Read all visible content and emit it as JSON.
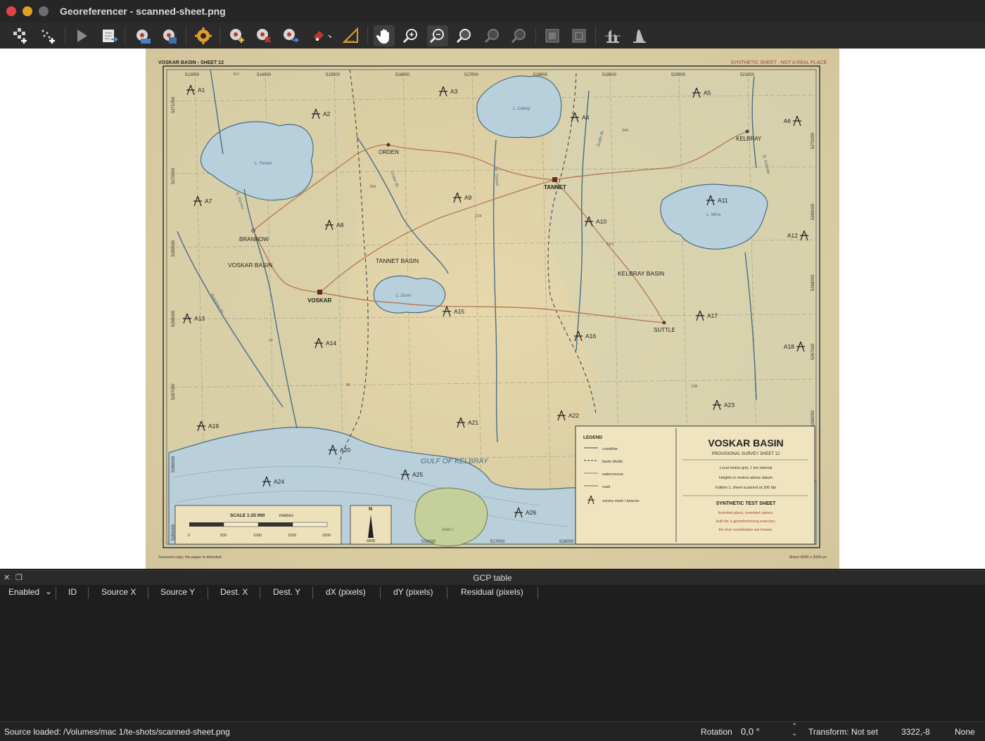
{
  "window": {
    "title": "Georeferencer - scanned-sheet.png"
  },
  "toolbar": {
    "icons": [
      "add-raster-icon",
      "add-point-icon",
      "start-georeferencing-icon",
      "generate-script-icon",
      "load-gcp-icon",
      "save-gcp-icon",
      "transformation-settings-icon",
      "add-gcp-icon",
      "delete-gcp-icon",
      "move-gcp-icon",
      "move-gcp-dest-icon",
      "full-histogram-icon",
      "pan-icon",
      "zoom-in-icon",
      "zoom-out-icon",
      "zoom-to-layer-icon",
      "zoom-last-icon",
      "zoom-next-icon",
      "link-georef-icon",
      "link-qgis-icon",
      "local-histogram-icon",
      "full-histogram-stretch-icon"
    ]
  },
  "map": {
    "sheet_label": "VOSKAR BASIN - SHEET 12",
    "disclaimer": "SYNTHETIC SHEET · NOT A REAL PLACE",
    "footer_left": "Scanned copy; the paper is distorted.",
    "footer_right": "Sheet 4000 x 3000 px",
    "eastings": [
      "513000",
      "514000",
      "515000",
      "516000",
      "517000",
      "518000",
      "519000",
      "520000",
      "521000"
    ],
    "northings": [
      "5271000",
      "5270000",
      "5269000",
      "5268000",
      "5268000",
      "5267000",
      "5266000",
      "5265000"
    ],
    "right_northings": [
      "5270000",
      "5269000",
      "5268000",
      "5267000",
      "5266000"
    ],
    "bottom_eastings": [
      "516000",
      "517000",
      "518000"
    ],
    "places": {
      "orden": "ORDEN",
      "tannet": "TANNET",
      "kelbray": "KELBRAY",
      "brannow": "BRANNOW",
      "voskar": "VOSKAR",
      "suttle": "SUTTLE",
      "voskar_basin": "VOSKAR BASIN",
      "tannet_basin": "TANNET BASIN",
      "kelbray_basin": "KELBRAY BASIN",
      "gulf": "GULF OF KELBRAY"
    },
    "lakes": {
      "ferren": "L. Ferren",
      "catrey": "L. Catrey",
      "mirra": "L. Mirra",
      "dunn": "L. Dunn",
      "island": "Ardo I."
    },
    "rivers": {
      "r1": "R. Ferren",
      "r2": "Orden Br.",
      "r3": "R. Tannet",
      "r4": "Suttle Br.",
      "r5": "R. Kelbray",
      "r6": "Brannow Br."
    },
    "heights": [
      "412",
      "344",
      "268",
      "224",
      "183",
      "47",
      "96",
      "138"
    ],
    "gcps": [
      "A1",
      "A2",
      "A3",
      "A4",
      "A5",
      "A6",
      "A7",
      "A8",
      "A9",
      "A10",
      "A11",
      "A12",
      "A13",
      "A14",
      "A15",
      "A16",
      "A17",
      "A18",
      "A19",
      "A20",
      "A21",
      "A22",
      "A23",
      "A24",
      "A25",
      "A26"
    ],
    "scale": {
      "title": "SCALE 1:25 000",
      "units": "metres",
      "ticks": [
        "0",
        "500",
        "1000",
        "1500",
        "2000"
      ]
    },
    "north": {
      "n": "N",
      "grid": "GRID"
    },
    "legend": {
      "heading": "LEGEND",
      "items": [
        "coastline",
        "basin divide",
        "watercourse",
        "road",
        "survey mark / beacon"
      ],
      "title": "VOSKAR BASIN",
      "subtitle": "PROVISIONAL SURVEY SHEET 12",
      "notes": [
        "Local metric grid, 1 km interval",
        "Heights in metres above datum",
        "Edition 1, sheet scanned at 300 dpi"
      ],
      "warn_title": "SYNTHETIC TEST SHEET",
      "warn_lines": [
        "Invented place, invented names,",
        "built for a georeferencing exercise;",
        "the true coordinates are known."
      ]
    }
  },
  "gcp_panel": {
    "title": "GCP table",
    "columns": [
      "Enabled",
      "ID",
      "Source X",
      "Source Y",
      "Dest. X",
      "Dest. Y",
      "dX (pixels)",
      "dY (pixels)",
      "Residual (pixels)"
    ]
  },
  "status": {
    "source": "Source loaded: /Volumes/mac 1/te-shots/scanned-sheet.png",
    "rotation_label": "Rotation",
    "rotation_value": "0,0 °",
    "transform": "Transform: Not set",
    "coords": "3322,-8",
    "crs": "None"
  }
}
